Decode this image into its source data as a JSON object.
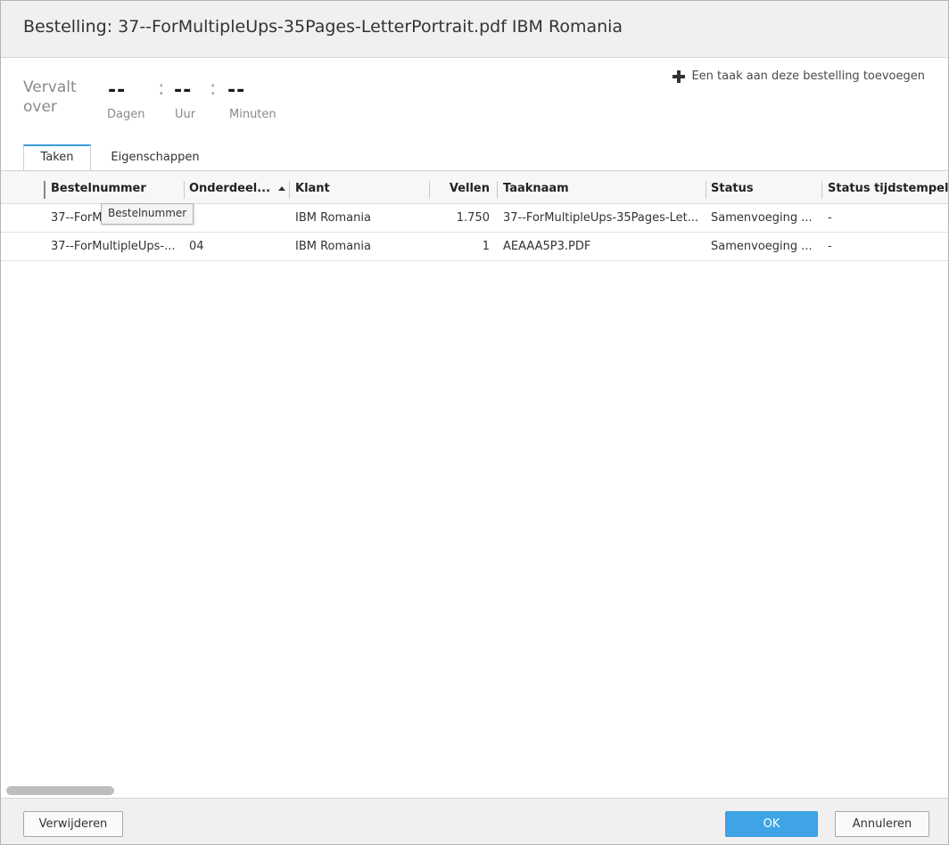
{
  "dialog": {
    "title": "Bestelling:  37--ForMultipleUps-35Pages-LetterPortrait.pdf IBM Romania"
  },
  "header": {
    "add_task_label": "Een taak aan deze bestelling toevoegen",
    "add_task_icon": "plus-icon",
    "due": {
      "label_line1": "Vervalt",
      "label_line2": "over",
      "days_value": "--",
      "hours_value": "--",
      "minutes_value": "--",
      "separator": ":",
      "days_unit": "Dagen",
      "hours_unit": "Uur",
      "minutes_unit": "Minuten"
    }
  },
  "tabs": [
    {
      "label": "Taken",
      "active": true
    },
    {
      "label": "Eigenschappen",
      "active": false
    }
  ],
  "grid": {
    "columns": [
      {
        "label": "Bestelnummer"
      },
      {
        "label": "Onderdeel...",
        "sorted": "ascending"
      },
      {
        "label": "Klant"
      },
      {
        "label": "Vellen"
      },
      {
        "label": "Taaknaam"
      },
      {
        "label": "Status"
      },
      {
        "label": "Status tijdstempel"
      }
    ],
    "rows": [
      {
        "order_number": "37--ForMultipleUps-...",
        "part": "",
        "client": "IBM Romania",
        "sheets": "1.750",
        "task_name": "37--ForMultipleUps-35Pages-Let...",
        "status": "Samenvoeging ...",
        "status_timestamp": "-"
      },
      {
        "order_number": "37--ForMultipleUps-...",
        "part": "04",
        "client": "IBM Romania",
        "sheets": "1",
        "task_name": "AEAAA5P3.PDF",
        "status": "Samenvoeging ...",
        "status_timestamp": "-"
      }
    ],
    "tooltip": "Bestelnummer"
  },
  "footer": {
    "delete_label": "Verwijderen",
    "ok_label": "OK",
    "cancel_label": "Annuleren"
  },
  "colors": {
    "accent": "#3fa4e6",
    "title_bar_bg": "#f0f0f0"
  }
}
